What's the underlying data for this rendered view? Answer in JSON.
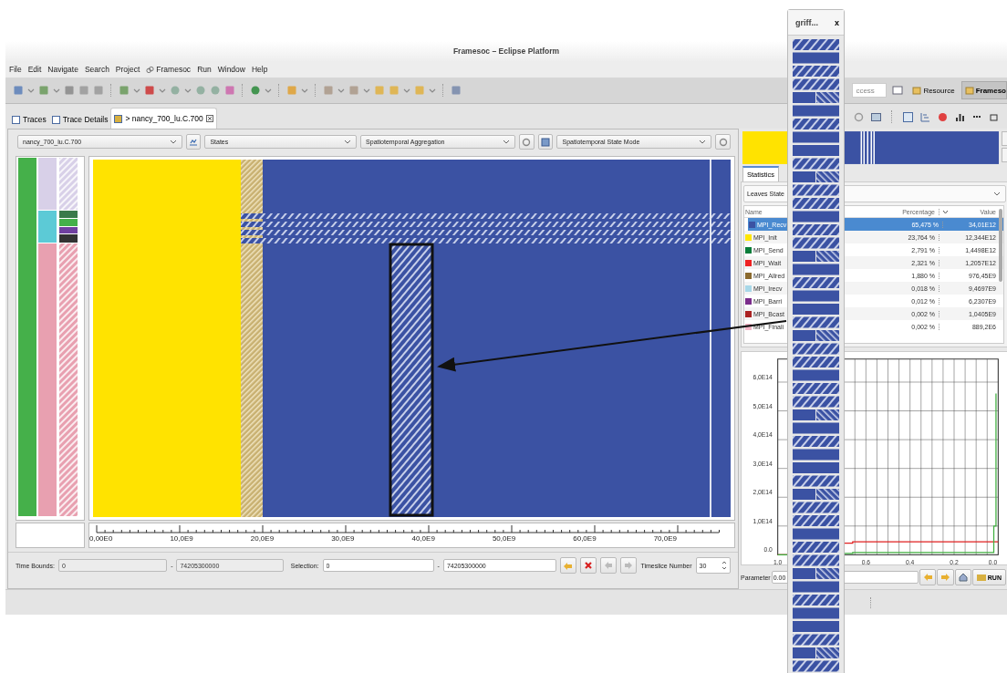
{
  "window": {
    "title": "Framesoc – Eclipse Platform"
  },
  "menu": [
    {
      "label": "File",
      "icon": false
    },
    {
      "label": "Edit",
      "icon": false
    },
    {
      "label": "Navigate",
      "icon": false
    },
    {
      "label": "Search",
      "icon": false
    },
    {
      "label": "Project",
      "icon": false
    },
    {
      "label": "Framesoc",
      "icon": true
    },
    {
      "label": "Run",
      "icon": false
    },
    {
      "label": "Window",
      "icon": false
    },
    {
      "label": "Help",
      "icon": false
    }
  ],
  "quick_access": {
    "placeholder": "ccess"
  },
  "perspectives": [
    {
      "label": "Resource",
      "selected": false
    },
    {
      "label": "Frameso",
      "selected": true
    }
  ],
  "editor_tabs": [
    {
      "label": "Traces",
      "selected": false
    },
    {
      "label": "Trace Details",
      "selected": false
    },
    {
      "label": "> nancy_700_lu.C.700",
      "selected": true
    }
  ],
  "combos": {
    "trace": "nancy_700_lu.C.700",
    "type": "States",
    "operator": "Spatiotemporal Aggregation",
    "mode": "Spatiotemporal State Mode"
  },
  "time_axis": [
    "0,00E0",
    "10,0E9",
    "20,0E9",
    "30,0E9",
    "40,0E9",
    "50,0E9",
    "60,0E9",
    "70,0E9"
  ],
  "bounds_bar": {
    "time_bounds_label": "Time Bounds:",
    "fields": [
      {
        "value": "0",
        "disabled": true
      },
      {
        "value": "74205300000",
        "disabled": true
      },
      {
        "value": "0",
        "disabled": false
      },
      {
        "value": "74205300000",
        "disabled": false
      }
    ],
    "separator": "-",
    "selection_label": "Selection:",
    "timeslice_label": "Timeslice Number",
    "timeslice": "30"
  },
  "statistics": {
    "tab": "Statistics",
    "combo": "Leaves State",
    "columns": [
      "Name",
      "Percentage",
      "Value"
    ],
    "rows": [
      {
        "name": "MPI_Recv",
        "color": "#3b52a3",
        "percentage": "65,475 %",
        "value": "34,01E12",
        "selected": true
      },
      {
        "name": "MPI_Init",
        "color": "#ffe600",
        "percentage": "23,764 %",
        "value": "12,344E12",
        "selected": false
      },
      {
        "name": "MPI_Send",
        "color": "#0a7d3a",
        "percentage": "2,791 %",
        "value": "1,4498E12",
        "selected": false
      },
      {
        "name": "MPI_Wait",
        "color": "#ee2222",
        "percentage": "2,321 %",
        "value": "1,2057E12",
        "selected": false
      },
      {
        "name": "MPI_Allred",
        "color": "#8b6a2e",
        "percentage": "1,880 %",
        "value": "976,45E9",
        "selected": false
      },
      {
        "name": "MPI_Irecv",
        "color": "#a8d8e8",
        "percentage": "0,018 %",
        "value": "9,4697E9",
        "selected": false
      },
      {
        "name": "MPI_Barri",
        "color": "#7b2d8b",
        "percentage": "0,012 %",
        "value": "6,2307E9",
        "selected": false
      },
      {
        "name": "MPI_Bcast",
        "color": "#aa2222",
        "percentage": "0,002 %",
        "value": "1,0405E9",
        "selected": false
      },
      {
        "name": "MPI_Finali",
        "color": "#f4b6c8",
        "percentage": "0,002 %",
        "value": "889,2E6",
        "selected": false
      }
    ]
  },
  "chart": {
    "x_labels": [
      "1.0",
      "0.6",
      "0.4",
      "0.2",
      "0.0"
    ],
    "y_labels": [
      "6,0E14",
      "5,0E14",
      "4,0E14",
      "3,0E14",
      "2,0E14",
      "1,0E14",
      "0.0"
    ]
  },
  "parameter": {
    "label": "Parameter",
    "value": "0.00",
    "run": "RUN"
  },
  "floating_window": {
    "title": "griff...",
    "close": "x"
  }
}
